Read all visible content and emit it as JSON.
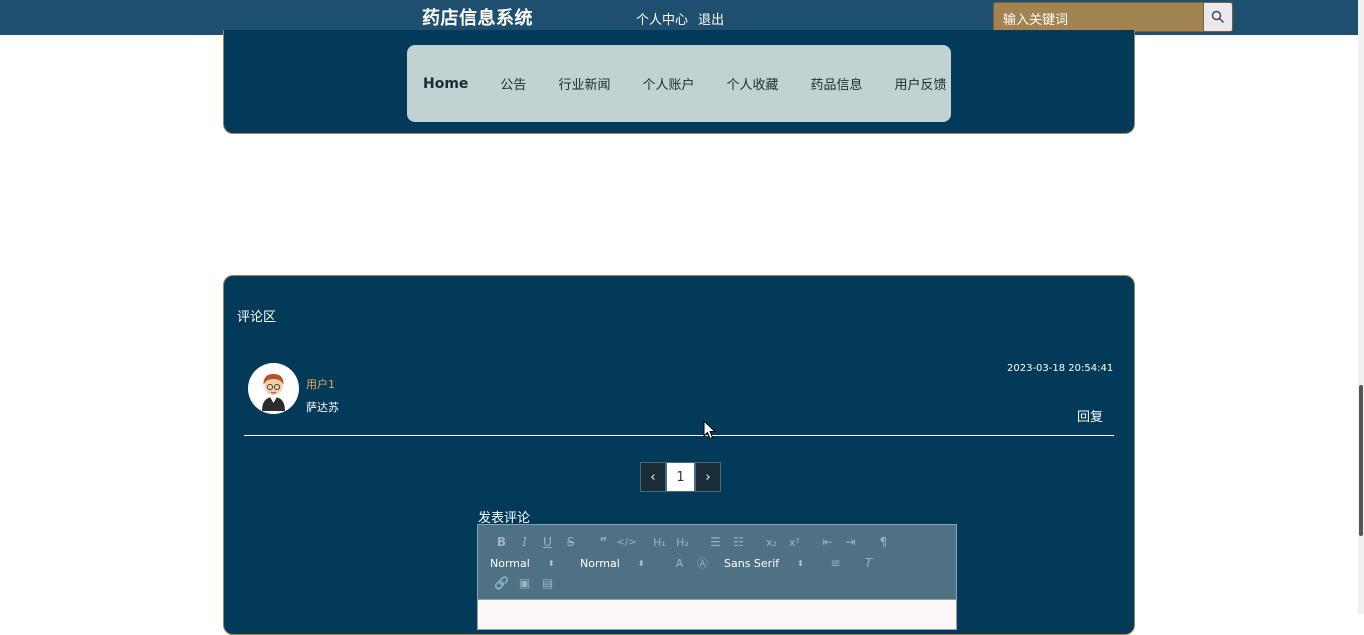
{
  "header": {
    "site_title": "药店信息系统",
    "links": [
      "个人中心",
      "退出"
    ],
    "search_placeholder": "输入关键词"
  },
  "nav": {
    "items": [
      "Home",
      "公告",
      "行业新闻",
      "个人账户",
      "个人收藏",
      "药品信息",
      "用户反馈"
    ]
  },
  "comments": {
    "heading": "评论区",
    "list": [
      {
        "username": "用户1",
        "text": "萨达苏",
        "time": "2023-03-18 20:54:41",
        "reply_label": "回复"
      }
    ]
  },
  "pagination": {
    "prev": "‹",
    "current": "1",
    "next": "›"
  },
  "post": {
    "label": "发表评论",
    "toolbar": {
      "header_select": "Normal",
      "size_select": "Normal",
      "font_select": "Sans Serif"
    }
  },
  "colors": {
    "topbar": "#1f4f6e",
    "panel": "#033a5a",
    "nav_bg": "#c1d2d2",
    "search_bg": "#a3834f",
    "username": "#e3a95a"
  }
}
